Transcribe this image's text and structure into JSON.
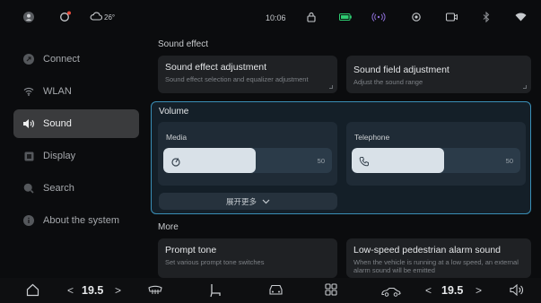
{
  "status": {
    "weather": "26°",
    "time": "10:06",
    "icons": [
      "user-icon",
      "ev-icon",
      "cloud-icon",
      "lock-icon",
      "battery-icon",
      "signal-waves-icon",
      "location-icon",
      "camera-icon",
      "bluetooth-icon",
      "wifi-icon"
    ],
    "battery_color": "#2ecc71"
  },
  "sidebar": {
    "items": [
      {
        "label": "Connect",
        "icon": "connect-icon",
        "active": false
      },
      {
        "label": "WLAN",
        "icon": "wifi-icon",
        "active": false
      },
      {
        "label": "Sound",
        "icon": "speaker-icon",
        "active": true
      },
      {
        "label": "Display",
        "icon": "display-icon",
        "active": false
      },
      {
        "label": "Search",
        "icon": "search-icon",
        "active": false
      },
      {
        "label": "About the system",
        "icon": "info-icon",
        "active": false
      }
    ]
  },
  "sound_effect": {
    "title": "Sound effect",
    "adjustment": {
      "title": "Sound effect adjustment",
      "subtitle": "Sound effect selection and equalizer adjustment"
    },
    "field": {
      "title": "Sound field adjustment",
      "subtitle": "Adjust the sound range"
    }
  },
  "volume": {
    "title": "Volume",
    "media": {
      "label": "Media",
      "value": "50",
      "level": 0.55
    },
    "telephone": {
      "label": "Telephone",
      "value": "50",
      "level": 0.55
    },
    "expand_label": "展开更多"
  },
  "more": {
    "title": "More",
    "prompt": {
      "title": "Prompt tone",
      "subtitle": "Set various prompt tone switches"
    },
    "pedestrian": {
      "title": "Low-speed pedestrian alarm sound",
      "subtitle": "When the vehicle is running at a low speed, an external alarm sound will be emitted"
    }
  },
  "bottom": {
    "left_temp": "19.5",
    "right_temp": "19.5",
    "prev_arrow": "<",
    "next_arrow": ">"
  },
  "colors": {
    "accent": "#3a8fb7",
    "background": "#0b0c0e",
    "card": "#1f2124"
  }
}
